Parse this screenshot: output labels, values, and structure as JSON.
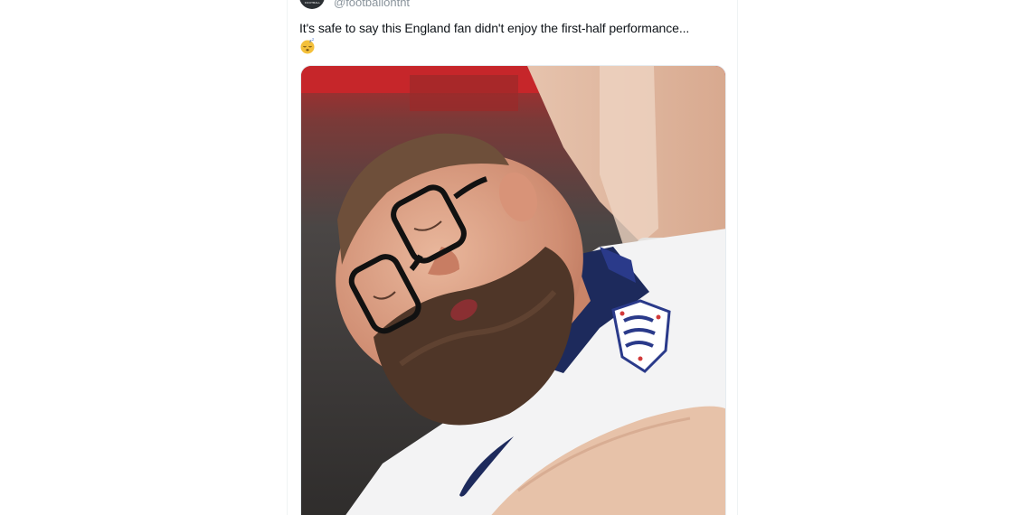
{
  "tweet": {
    "avatar_text": "FOOTBALL",
    "handle": "@footballontnt",
    "text": "It's safe to say this England fan didn't enjoy the first-half performance...",
    "emoji": "sleeping-face-icon"
  },
  "media": {
    "alt": "England fan asleep in the stands wearing glasses and an England shirt"
  },
  "colors": {
    "text": "#0f1419",
    "secondary": "#8a949c",
    "border": "#eff3f4",
    "shirt_navy": "#1d2a5c",
    "crest_blue": "#2a3a8a"
  }
}
